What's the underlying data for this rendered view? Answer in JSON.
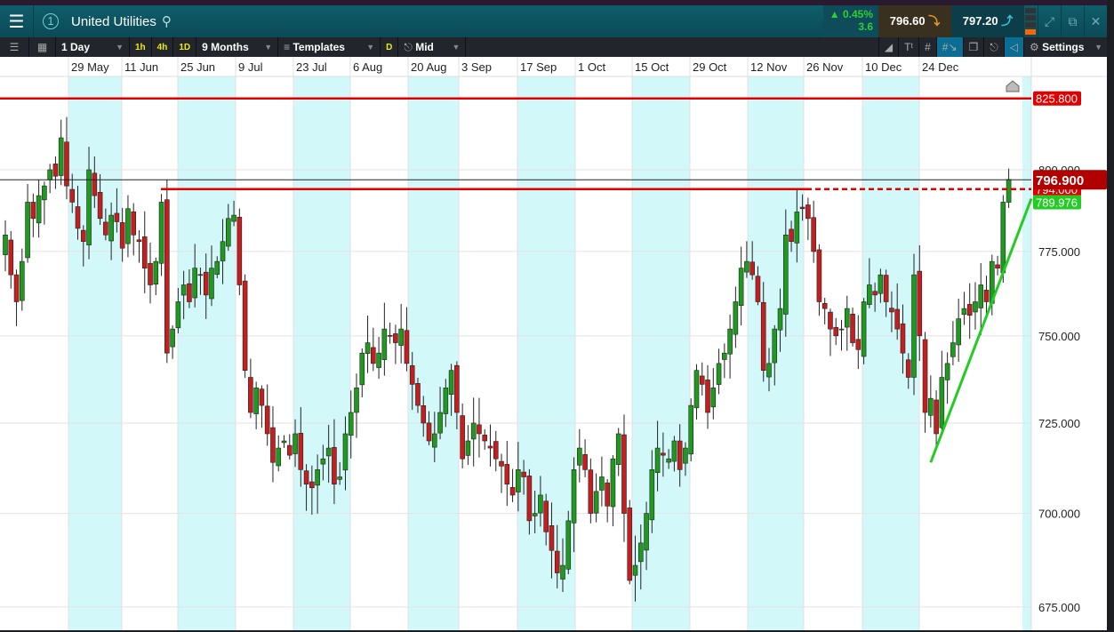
{
  "header": {
    "title": "United Utilities",
    "tab_number": "1",
    "change_pct": "0.45%",
    "change_abs": "3.6",
    "sell": "796.60",
    "buy": "797.20"
  },
  "toolbar": {
    "interval": "1 Day",
    "quick": [
      "1h",
      "4h",
      "1D"
    ],
    "range": "9 Months",
    "templates": "Templates",
    "d_label": "D",
    "price_type": "Mid",
    "settings": "Settings"
  },
  "chart_data": {
    "type": "candlestick",
    "instrument": "United Utilities",
    "x_labels": [
      "29 May",
      "11 Jun",
      "25 Jun",
      "9 Jul",
      "23 Jul",
      "6 Aug",
      "20 Aug",
      "3 Sep",
      "17 Sep",
      "1 Oct",
      "15 Oct",
      "29 Oct",
      "12 Nov",
      "26 Nov",
      "10 Dec",
      "24 Dec"
    ],
    "y_ticks": [
      "800.000",
      "775.000",
      "750.000",
      "725.000",
      "700.000",
      "675.000"
    ],
    "y_tick_values": [
      800,
      775,
      750,
      725,
      700,
      675
    ],
    "ylim": [
      672,
      832
    ],
    "scale": "log",
    "close": [
      780,
      768,
      760,
      772,
      790,
      785,
      792,
      795,
      800,
      798,
      810,
      795,
      790,
      782,
      778,
      800,
      792,
      785,
      780,
      786,
      784,
      776,
      788,
      780,
      778,
      770,
      765,
      772,
      790,
      745,
      752,
      760,
      765,
      760,
      770,
      768,
      762,
      770,
      772,
      778,
      785,
      786,
      765,
      740,
      728,
      735,
      730,
      722,
      714,
      718,
      720,
      716,
      722,
      712,
      708,
      707,
      712,
      715,
      718,
      708,
      710,
      722,
      728,
      735,
      745,
      748,
      742,
      745,
      752,
      750,
      748,
      752,
      742,
      736,
      730,
      725,
      720,
      722,
      728,
      735,
      740,
      728,
      715,
      720,
      725,
      722,
      720,
      718,
      715,
      713,
      708,
      705,
      712,
      710,
      698,
      700,
      705,
      695,
      690,
      684,
      686,
      698,
      712,
      718,
      712,
      700,
      706,
      710,
      702,
      715,
      722,
      700,
      682,
      686,
      692,
      700,
      712,
      718,
      716,
      715,
      720,
      712,
      718,
      730,
      740,
      736,
      728,
      735,
      742,
      745,
      752,
      760,
      770,
      772,
      768,
      760,
      740,
      742,
      752,
      758,
      780,
      778,
      787,
      788,
      785,
      775,
      760,
      758,
      752,
      750,
      752,
      758,
      748,
      746,
      760,
      765,
      762,
      768,
      760,
      757,
      752,
      745,
      738,
      768,
      750,
      728,
      732,
      722,
      738,
      742,
      748,
      755,
      758,
      756,
      760,
      765,
      760,
      772,
      770,
      790,
      797
    ],
    "levels": {
      "resistance_top": "825.800",
      "resistance_mid": "794.000",
      "current": "796.900",
      "trend": "789.976"
    },
    "level_values": {
      "resistance_top": 822.5,
      "resistance_mid": 794,
      "current": 796.9
    },
    "trendline": {
      "from_index": 166,
      "from_price": 714,
      "to_price": 789.976
    },
    "colors": {
      "up": "#1e9a1e",
      "down": "#c41e1e",
      "resistance": "#e00000",
      "trend": "#22cc22"
    }
  }
}
